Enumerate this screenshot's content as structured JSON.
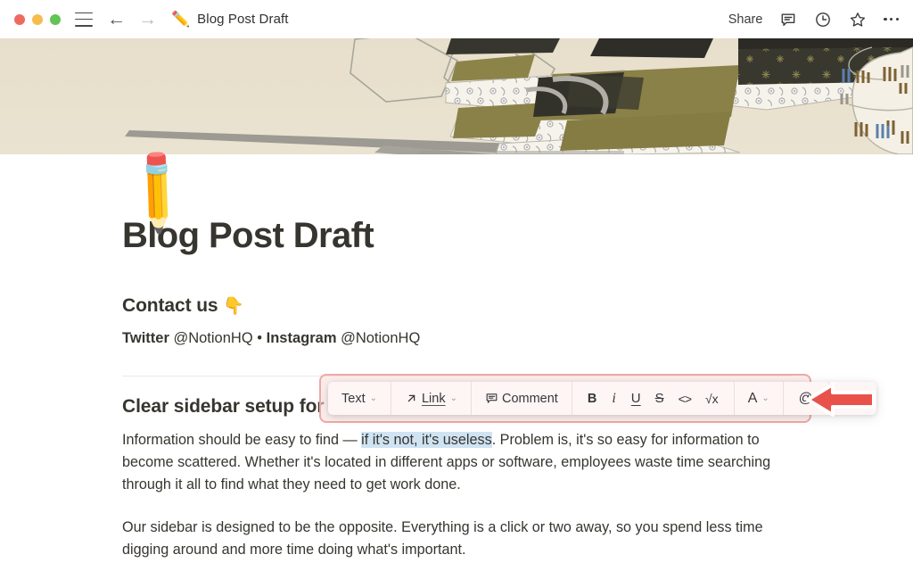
{
  "titlebar": {
    "traffic_lights": [
      "close",
      "minimize",
      "maximize"
    ],
    "menu_icon": "hamburger-icon",
    "back_icon": "arrow-left-icon",
    "forward_icon": "arrow-right-icon",
    "doc_emoji": "✏️",
    "doc_title": "Blog Post Draft",
    "share_label": "Share",
    "comment_icon": "comment-icon",
    "history_icon": "clock-icon",
    "favorite_icon": "star-icon",
    "more_icon": "ellipsis-icon"
  },
  "cover": {
    "name": "cover-image",
    "description": "Japanese woodblock-style still life on beige paper",
    "colors": {
      "paper": "#e9e1ce",
      "olive": "#8a8145",
      "dark": "#3b3a32",
      "pattern": "#f5f2e8",
      "pattern_ink": "#9a9aa6",
      "jar": "#f4f0e6",
      "jar_brown": "#8a6a3a",
      "jar_blue": "#5b7fb0"
    }
  },
  "page": {
    "icon_emoji": "✏️",
    "title": "Blog Post Draft",
    "contact_heading": "Contact us",
    "contact_emoji": "👇",
    "socials": {
      "twitter_label": "Twitter",
      "twitter_handle": "@NotionHQ",
      "separator": "•",
      "instagram_label": "Instagram",
      "instagram_handle": "@NotionHQ"
    },
    "section_heading": "Clear sidebar setup for e",
    "paragraph_1_pre": "Information should be easy to find — ",
    "paragraph_1_selected": "if it's not, it's useless",
    "paragraph_1_post": ". Problem is, it's so easy for information to become scattered. Whether it's located in different apps or software, employees waste time searching through it all to find what they need to get work done.",
    "paragraph_2": "Our sidebar is designed to be the opposite. Everything is a click or two away, so you spend less time digging around and more time doing what's important."
  },
  "format_toolbar": {
    "text_label": "Text",
    "link_label": "Link",
    "comment_label": "Comment",
    "bold_label": "B",
    "italic_label": "i",
    "underline_label": "U",
    "strikethrough_label": "S",
    "code_label": "<>",
    "equation_label": "√x",
    "color_label": "A",
    "mention_label": "@",
    "more_label": "•••",
    "chevron": "⌄"
  },
  "annotation": {
    "highlight_color": "#f0a9a5",
    "arrow_color": "#e8524a",
    "arrow_direction": "left"
  },
  "colors": {
    "text": "#37352f",
    "selection_highlight": "#cfe3f3",
    "toolbar_bg": "#fdf6f5",
    "divider": "#e9e9e7"
  }
}
